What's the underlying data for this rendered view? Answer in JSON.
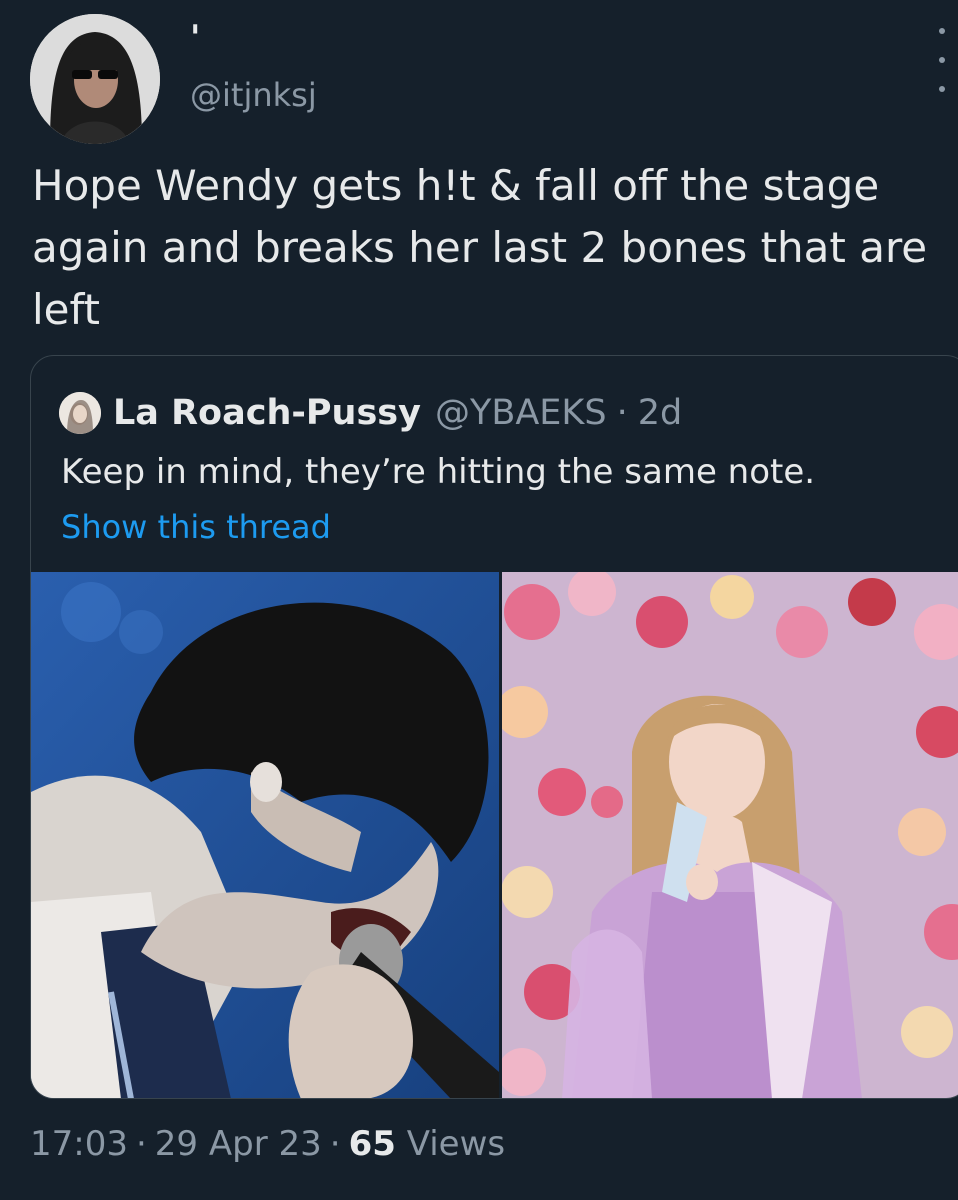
{
  "author": {
    "display_name": "'",
    "handle": "@itjnksj"
  },
  "tweet": {
    "text": "Hope Wendy gets h!t & fall off the stage again and breaks her last 2 bones that are left"
  },
  "quoted_tweet": {
    "name": "La Roach-Pussy",
    "handle": "@YBAEKS",
    "separator": "·",
    "time": "2d",
    "text": "Keep in mind, they’re hitting the same note.",
    "show_thread": "Show this thread"
  },
  "meta": {
    "time": "17:03",
    "separator": "·",
    "date": "29 Apr 23",
    "views_count": "65",
    "views_label": "Views"
  },
  "icons": {
    "more": "more-vertical-icon"
  },
  "colors": {
    "background": "#15202b",
    "text": "#e7e9ea",
    "muted": "#8b98a5",
    "link": "#1d9bf0",
    "border": "#38444d"
  }
}
